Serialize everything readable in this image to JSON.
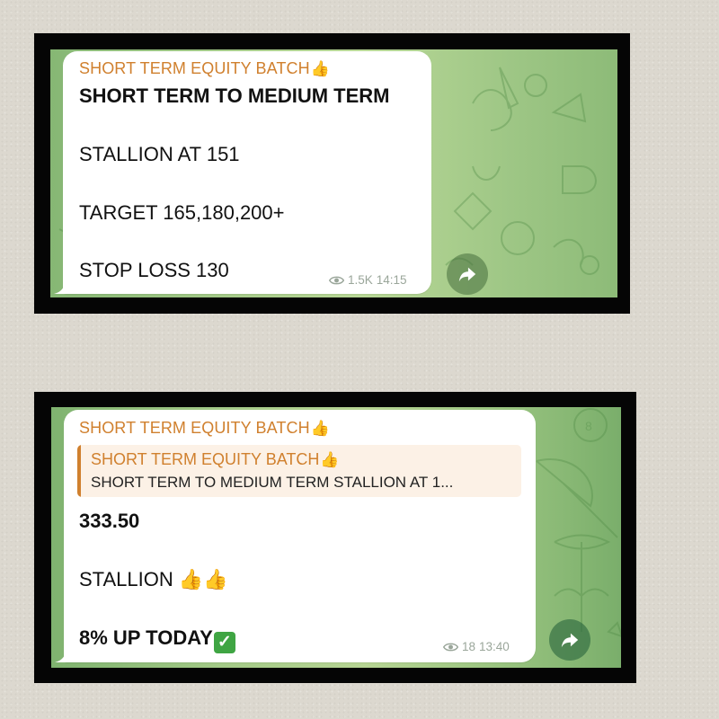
{
  "card1": {
    "sender": "SHORT TERM EQUITY BATCH",
    "heading": "SHORT TERM TO MEDIUM TERM",
    "line1": "STALLION AT 151",
    "line2": "TARGET 165,180,200+",
    "line3": "STOP LOSS 130",
    "views": "1.5K",
    "time": "14:15"
  },
  "card2": {
    "sender": "SHORT TERM EQUITY BATCH",
    "quote_sender": "SHORT TERM EQUITY BATCH",
    "quote_text": "SHORT TERM TO MEDIUM TERM STALLION AT 1...",
    "price": "333.50",
    "stock": "STALLION",
    "up_text": "8% UP TODAY",
    "views": "18",
    "time": "13:40"
  },
  "icons": {
    "thumbs": "thumbs-up-icon",
    "views": "eye-icon",
    "forward": "forward-share-icon",
    "check": "check-mark-icon"
  },
  "colors": {
    "sender_orange": "#d0802e",
    "chat_green": "#a9cd8c",
    "check_green": "#3fa543"
  }
}
